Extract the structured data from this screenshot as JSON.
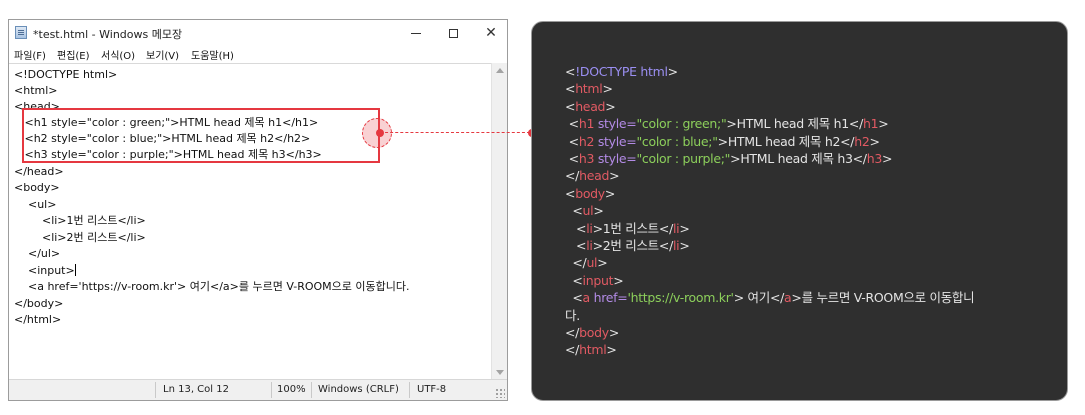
{
  "window": {
    "title": "*test.html - Windows 메모장",
    "minimize": "—",
    "maximize": "☐",
    "close": "✕"
  },
  "menu": [
    "파일(F)",
    "편집(E)",
    "서식(O)",
    "보기(V)",
    "도움말(H)"
  ],
  "editor_lines": [
    "<!DOCTYPE html>",
    "<html>",
    "<head>",
    "   <h1 style=\"color : green;\">HTML head 제목 h1</h1>",
    "   <h2 style=\"color : blue;\">HTML head 제목 h2</h2>",
    "   <h3 style=\"color : purple;\">HTML head 제목 h3</h3>",
    "</head>",
    "<body>",
    "    <ul>",
    "        <li>1번 리스트</li>",
    "        <li>2번 리스트</li>",
    "    </ul>",
    "    <input>",
    "    <a href='https://v-room.kr'> 여기</a>를 누르면 V-ROOM으로 이동합니다.",
    "</body>",
    "</html>"
  ],
  "status": {
    "position": "Ln 13, Col 12",
    "zoom": "100%",
    "line_ending": "Windows (CRLF)",
    "encoding": "UTF-8"
  },
  "highlight_color": "#e53840",
  "code_panel": {
    "background": "#2f2f2f",
    "lines": [
      [
        [
          "punc",
          "<"
        ],
        [
          "doc",
          "!DOCTYPE html"
        ],
        [
          "punc",
          ">"
        ]
      ],
      [
        [
          "punc",
          "<"
        ],
        [
          "tag",
          "html"
        ],
        [
          "punc",
          ">"
        ]
      ],
      [
        [
          "punc",
          "<"
        ],
        [
          "tag",
          "head"
        ],
        [
          "punc",
          ">"
        ]
      ],
      [
        [
          "punc",
          " <"
        ],
        [
          "tag",
          "h1"
        ],
        [
          "attr",
          " style="
        ],
        [
          "str",
          "\"color : green;\""
        ],
        [
          "punc",
          ">"
        ],
        [
          "text",
          "HTML head 제목 h1"
        ],
        [
          "punc",
          "</"
        ],
        [
          "tag",
          "h1"
        ],
        [
          "punc",
          ">"
        ]
      ],
      [
        [
          "punc",
          " <"
        ],
        [
          "tag",
          "h2"
        ],
        [
          "attr",
          " style="
        ],
        [
          "str",
          "\"color : blue;\""
        ],
        [
          "punc",
          ">"
        ],
        [
          "text",
          "HTML head 제목 h2"
        ],
        [
          "punc",
          "</"
        ],
        [
          "tag",
          "h2"
        ],
        [
          "punc",
          ">"
        ]
      ],
      [
        [
          "punc",
          " <"
        ],
        [
          "tag",
          "h3"
        ],
        [
          "attr",
          " style="
        ],
        [
          "str",
          "\"color : purple;\""
        ],
        [
          "punc",
          ">"
        ],
        [
          "text",
          "HTML head 제목 h3"
        ],
        [
          "punc",
          "</"
        ],
        [
          "tag",
          "h3"
        ],
        [
          "punc",
          ">"
        ]
      ],
      [
        [
          "punc",
          "</"
        ],
        [
          "tag",
          "head"
        ],
        [
          "punc",
          ">"
        ]
      ],
      [
        [
          "punc",
          "<"
        ],
        [
          "tag",
          "body"
        ],
        [
          "punc",
          ">"
        ]
      ],
      [
        [
          "punc",
          "  <"
        ],
        [
          "tag",
          "ul"
        ],
        [
          "punc",
          ">"
        ]
      ],
      [
        [
          "punc",
          "   <"
        ],
        [
          "tag",
          "li"
        ],
        [
          "punc",
          ">"
        ],
        [
          "text",
          "1번 리스트"
        ],
        [
          "punc",
          "</"
        ],
        [
          "tag",
          "li"
        ],
        [
          "punc",
          ">"
        ]
      ],
      [
        [
          "punc",
          "   <"
        ],
        [
          "tag",
          "li"
        ],
        [
          "punc",
          ">"
        ],
        [
          "text",
          "2번 리스트"
        ],
        [
          "punc",
          "</"
        ],
        [
          "tag",
          "li"
        ],
        [
          "punc",
          ">"
        ]
      ],
      [
        [
          "punc",
          "  </"
        ],
        [
          "tag",
          "ul"
        ],
        [
          "punc",
          ">"
        ]
      ],
      [
        [
          "punc",
          "  <"
        ],
        [
          "tag",
          "input"
        ],
        [
          "punc",
          ">"
        ]
      ],
      [
        [
          "punc",
          "  <"
        ],
        [
          "tag",
          "a"
        ],
        [
          "attr",
          " href="
        ],
        [
          "str",
          "'https://v-room.kr'"
        ],
        [
          "punc",
          "> "
        ],
        [
          "text",
          "여기"
        ],
        [
          "punc",
          "</"
        ],
        [
          "tag",
          "a"
        ],
        [
          "punc",
          ">"
        ],
        [
          "text",
          "를 누르면 V-ROOM으로 이동합니"
        ]
      ],
      [
        [
          "text",
          "다."
        ]
      ],
      [
        [
          "punc",
          "</"
        ],
        [
          "tag",
          "body"
        ],
        [
          "punc",
          ">"
        ]
      ],
      [
        [
          "punc",
          "</"
        ],
        [
          "tag",
          "html"
        ],
        [
          "punc",
          ">"
        ]
      ]
    ]
  }
}
